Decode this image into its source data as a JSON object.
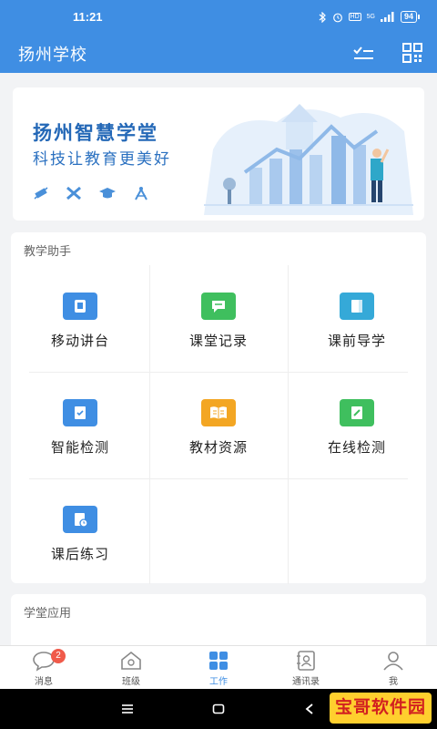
{
  "status_bar": {
    "time": "11:21",
    "network": "5G",
    "hd": "HD",
    "battery": "94"
  },
  "header": {
    "title": "扬州学校",
    "icons": [
      "checklist-icon",
      "qr-scan-icon"
    ]
  },
  "banner": {
    "title": "扬州智慧学堂",
    "subtitle": "科技让教育更美好",
    "icons": [
      "satellite-icon",
      "tools-icon",
      "graduation-cap-icon",
      "compass-icon"
    ]
  },
  "teaching_tools": {
    "title": "教学助手",
    "items": [
      {
        "label": "移动讲台",
        "icon": "tablet-icon",
        "color": "#3f8ee3"
      },
      {
        "label": "课堂记录",
        "icon": "chat-icon",
        "color": "#3fbf5e"
      },
      {
        "label": "课前导学",
        "icon": "book-guide-icon",
        "color": "#35a9d8"
      },
      {
        "label": "智能检测",
        "icon": "clipboard-check-icon",
        "color": "#3f8ee3"
      },
      {
        "label": "教材资源",
        "icon": "open-book-icon",
        "color": "#f3a623"
      },
      {
        "label": "在线检测",
        "icon": "edit-note-icon",
        "color": "#3fbf5e"
      },
      {
        "label": "课后练习",
        "icon": "clock-doc-icon",
        "color": "#3f8ee3"
      }
    ]
  },
  "classroom_apps": {
    "title": "学堂应用"
  },
  "tabbar": {
    "items": [
      {
        "label": "消息",
        "icon": "message-icon",
        "badge": "2"
      },
      {
        "label": "班级",
        "icon": "house-icon"
      },
      {
        "label": "工作",
        "icon": "grid-icon",
        "active": true
      },
      {
        "label": "通讯录",
        "icon": "contacts-icon"
      },
      {
        "label": "我",
        "icon": "user-icon"
      }
    ]
  },
  "navbar": {
    "watermark": "宝哥软件园"
  },
  "colors": {
    "primary": "#3f8ee3",
    "background": "#f2f3f5"
  }
}
